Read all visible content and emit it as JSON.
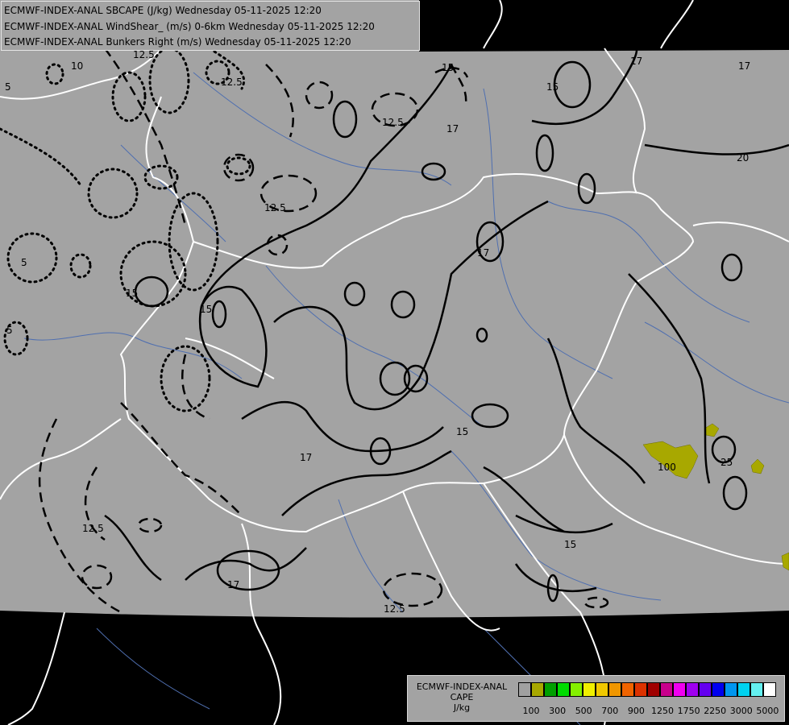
{
  "header": {
    "line1": "ECMWF-INDEX-ANAL SBCAPE (J/kg) Wednesday 05-11-2025 12:20",
    "line2": "ECMWF-INDEX-ANAL WindShear_ (m/s) 0-6km Wednesday 05-11-2025 12:20",
    "line3": "ECMWF-INDEX-ANAL Bunkers Right (m/s) Wednesday 05-11-2025 12:20"
  },
  "legend": {
    "title_line1": "ECMWF-INDEX-ANAL",
    "title_line2": "CAPE",
    "title_line3": "J/kg",
    "colors": [
      "#a0a0a0",
      "#a8a800",
      "#00a000",
      "#00dc00",
      "#84f000",
      "#f0f000",
      "#f0c800",
      "#f09600",
      "#f06400",
      "#dc3200",
      "#a00000",
      "#c8008c",
      "#f000f0",
      "#a000f0",
      "#6400f0",
      "#0000f0",
      "#0096f0",
      "#00d2f0",
      "#64f0f0",
      "#ffffff"
    ],
    "ticks": [
      "100",
      "300",
      "500",
      "700",
      "900",
      "1250",
      "1750",
      "2250",
      "3000",
      "5000"
    ]
  },
  "contour_labels": {
    "windshear": [
      "10",
      "12.5",
      "12.5",
      "12.5",
      "12.5",
      "12.5",
      "12.5",
      "15",
      "15",
      "15",
      "15",
      "15",
      "17",
      "17",
      "17",
      "17",
      "17",
      "17",
      "20",
      "25"
    ],
    "bunkers": [
      "5",
      "5",
      "5",
      "15"
    ],
    "cape": [
      "100"
    ]
  },
  "colors": {
    "domain_fill": "#a3a3a3",
    "outside": "#000000",
    "borders": "#ffffff",
    "rivers": "#4f6fb0",
    "cape_fill": "#a8a800"
  }
}
